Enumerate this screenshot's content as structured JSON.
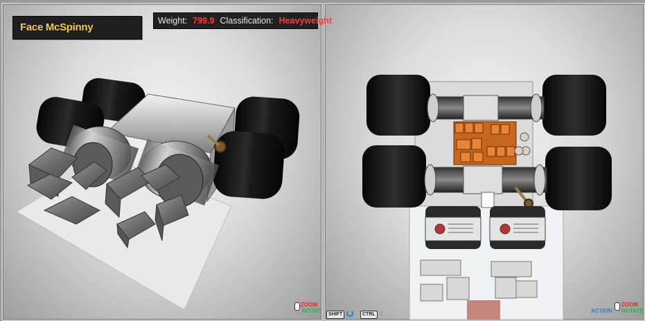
{
  "robot": {
    "name": "Face McSpinny",
    "weight_label": "Weight:",
    "weight_value": "799.9",
    "classification_label": "Classification:",
    "classification_value": "Heavyweight"
  },
  "left_hints": {
    "zoom": "ZOOM",
    "rotate": "ROTATE"
  },
  "right_hints": {
    "action": "ACTION",
    "zoom": "ZOOM",
    "rotate": "ROTATE"
  },
  "controls": {
    "shift": "SHIFT",
    "ctrl": "CTRL"
  },
  "colors": {
    "title_text": "#f2c45a",
    "highlight_red": "#ff3c3c",
    "zoom_red": "#e02828",
    "rotate_green": "#22b24a",
    "action_blue": "#2a7fd6"
  },
  "icons": [
    "rotate-icon",
    "up-down-arrow-icon",
    "mouse-icon"
  ]
}
